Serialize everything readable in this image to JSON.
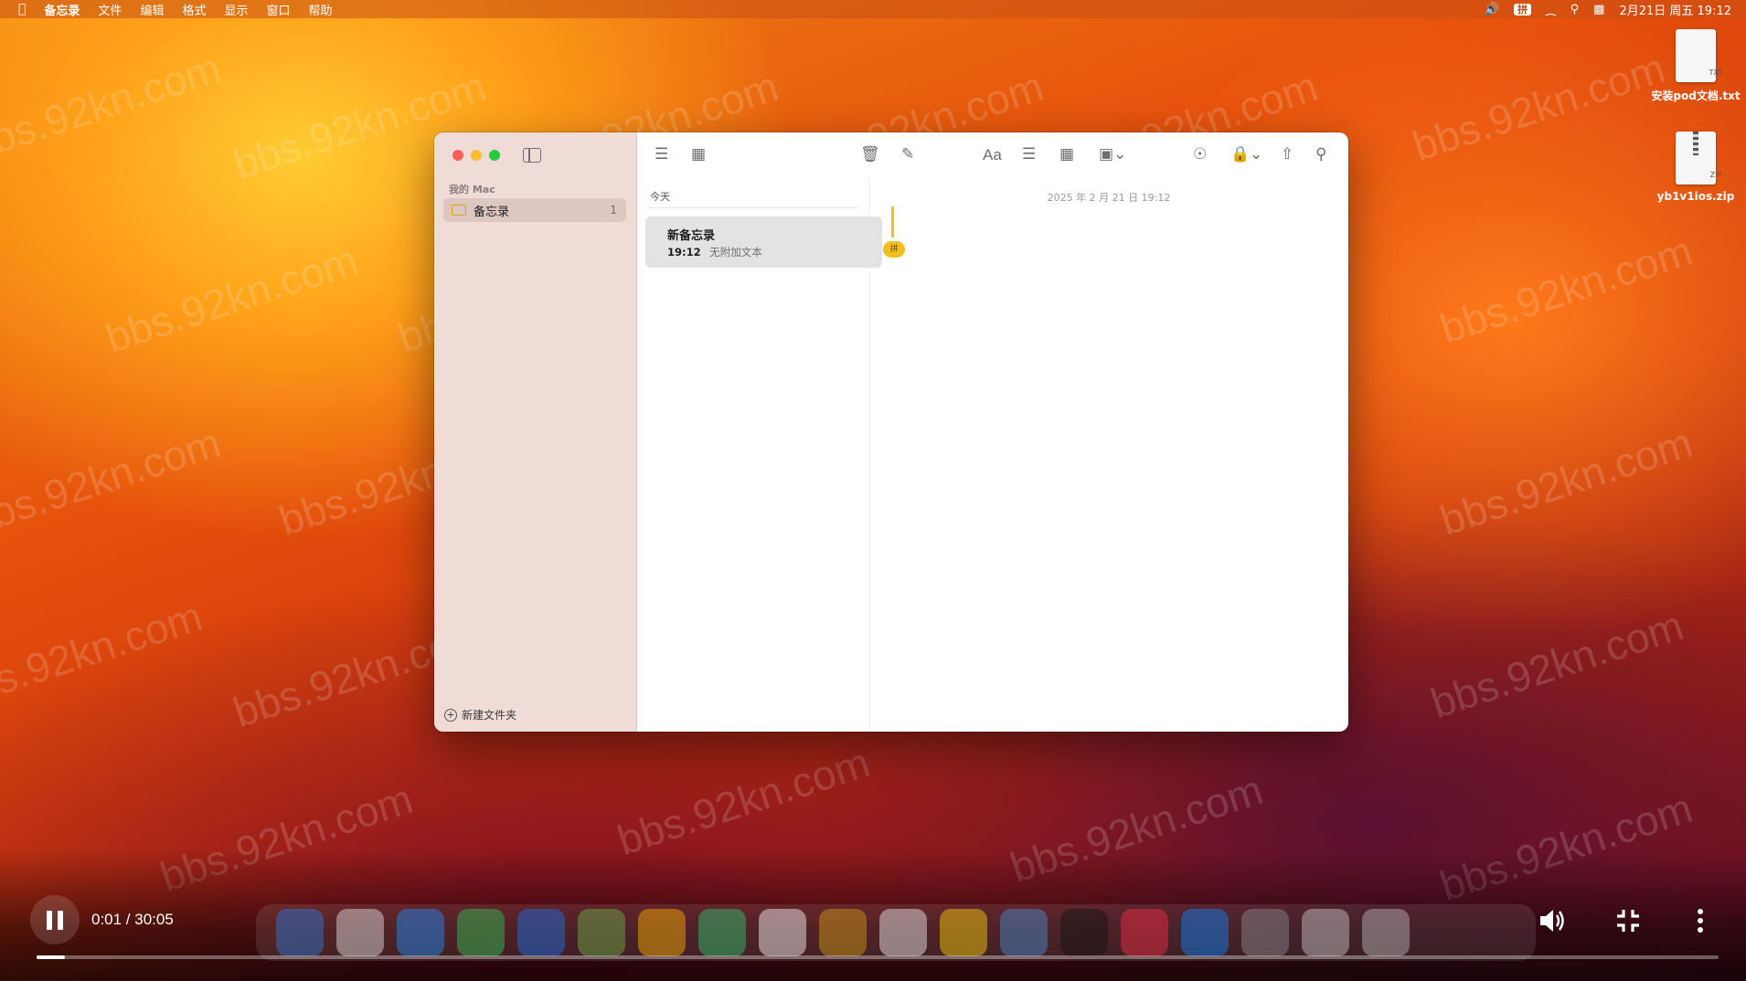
{
  "menubar": {
    "app_name": "备忘录",
    "menus": [
      "文件",
      "编辑",
      "格式",
      "显示",
      "窗口",
      "帮助"
    ],
    "ime": "拼",
    "datetime": "2月21日 周五  19:12"
  },
  "desktop": {
    "icons": [
      {
        "label": "安装pod文档.txt",
        "ext": "TXT"
      },
      {
        "label": "yb1v1ios.zip",
        "ext": "ZIP"
      }
    ],
    "watermark": "bbs.92kn.com"
  },
  "notes_window": {
    "sidebar": {
      "section_title": "我的 Mac",
      "folder": {
        "label": "备忘录",
        "count": "1"
      },
      "new_folder_label": "新建文件夹"
    },
    "list": {
      "group_header": "今天",
      "notes": [
        {
          "title": "新备忘录",
          "time": "19:12",
          "preview": "无附加文本"
        }
      ]
    },
    "editor": {
      "date": "2025 年 2 月 21 日 19:12",
      "ime_badge": "拼"
    },
    "toolbar_icons": [
      "list-view-icon",
      "gallery-view-icon",
      "trash-icon",
      "compose-icon",
      "text-format-icon",
      "checklist-icon",
      "table-icon",
      "media-icon",
      "collaborate-icon",
      "lock-icon",
      "share-icon",
      "search-icon"
    ]
  },
  "video_player": {
    "time": "0:01 / 30:05",
    "progress": 0.017
  }
}
